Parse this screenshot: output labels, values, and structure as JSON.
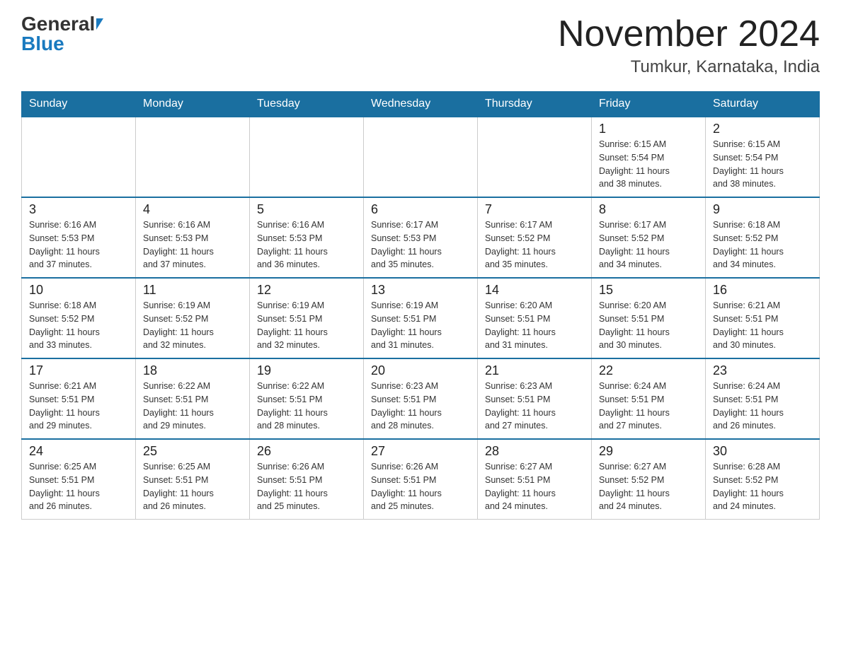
{
  "header": {
    "logo_general": "General",
    "logo_blue": "Blue",
    "month_title": "November 2024",
    "location": "Tumkur, Karnataka, India"
  },
  "weekdays": [
    "Sunday",
    "Monday",
    "Tuesday",
    "Wednesday",
    "Thursday",
    "Friday",
    "Saturday"
  ],
  "weeks": [
    {
      "days": [
        {
          "num": "",
          "info": ""
        },
        {
          "num": "",
          "info": ""
        },
        {
          "num": "",
          "info": ""
        },
        {
          "num": "",
          "info": ""
        },
        {
          "num": "",
          "info": ""
        },
        {
          "num": "1",
          "info": "Sunrise: 6:15 AM\nSunset: 5:54 PM\nDaylight: 11 hours\nand 38 minutes."
        },
        {
          "num": "2",
          "info": "Sunrise: 6:15 AM\nSunset: 5:54 PM\nDaylight: 11 hours\nand 38 minutes."
        }
      ]
    },
    {
      "days": [
        {
          "num": "3",
          "info": "Sunrise: 6:16 AM\nSunset: 5:53 PM\nDaylight: 11 hours\nand 37 minutes."
        },
        {
          "num": "4",
          "info": "Sunrise: 6:16 AM\nSunset: 5:53 PM\nDaylight: 11 hours\nand 37 minutes."
        },
        {
          "num": "5",
          "info": "Sunrise: 6:16 AM\nSunset: 5:53 PM\nDaylight: 11 hours\nand 36 minutes."
        },
        {
          "num": "6",
          "info": "Sunrise: 6:17 AM\nSunset: 5:53 PM\nDaylight: 11 hours\nand 35 minutes."
        },
        {
          "num": "7",
          "info": "Sunrise: 6:17 AM\nSunset: 5:52 PM\nDaylight: 11 hours\nand 35 minutes."
        },
        {
          "num": "8",
          "info": "Sunrise: 6:17 AM\nSunset: 5:52 PM\nDaylight: 11 hours\nand 34 minutes."
        },
        {
          "num": "9",
          "info": "Sunrise: 6:18 AM\nSunset: 5:52 PM\nDaylight: 11 hours\nand 34 minutes."
        }
      ]
    },
    {
      "days": [
        {
          "num": "10",
          "info": "Sunrise: 6:18 AM\nSunset: 5:52 PM\nDaylight: 11 hours\nand 33 minutes."
        },
        {
          "num": "11",
          "info": "Sunrise: 6:19 AM\nSunset: 5:52 PM\nDaylight: 11 hours\nand 32 minutes."
        },
        {
          "num": "12",
          "info": "Sunrise: 6:19 AM\nSunset: 5:51 PM\nDaylight: 11 hours\nand 32 minutes."
        },
        {
          "num": "13",
          "info": "Sunrise: 6:19 AM\nSunset: 5:51 PM\nDaylight: 11 hours\nand 31 minutes."
        },
        {
          "num": "14",
          "info": "Sunrise: 6:20 AM\nSunset: 5:51 PM\nDaylight: 11 hours\nand 31 minutes."
        },
        {
          "num": "15",
          "info": "Sunrise: 6:20 AM\nSunset: 5:51 PM\nDaylight: 11 hours\nand 30 minutes."
        },
        {
          "num": "16",
          "info": "Sunrise: 6:21 AM\nSunset: 5:51 PM\nDaylight: 11 hours\nand 30 minutes."
        }
      ]
    },
    {
      "days": [
        {
          "num": "17",
          "info": "Sunrise: 6:21 AM\nSunset: 5:51 PM\nDaylight: 11 hours\nand 29 minutes."
        },
        {
          "num": "18",
          "info": "Sunrise: 6:22 AM\nSunset: 5:51 PM\nDaylight: 11 hours\nand 29 minutes."
        },
        {
          "num": "19",
          "info": "Sunrise: 6:22 AM\nSunset: 5:51 PM\nDaylight: 11 hours\nand 28 minutes."
        },
        {
          "num": "20",
          "info": "Sunrise: 6:23 AM\nSunset: 5:51 PM\nDaylight: 11 hours\nand 28 minutes."
        },
        {
          "num": "21",
          "info": "Sunrise: 6:23 AM\nSunset: 5:51 PM\nDaylight: 11 hours\nand 27 minutes."
        },
        {
          "num": "22",
          "info": "Sunrise: 6:24 AM\nSunset: 5:51 PM\nDaylight: 11 hours\nand 27 minutes."
        },
        {
          "num": "23",
          "info": "Sunrise: 6:24 AM\nSunset: 5:51 PM\nDaylight: 11 hours\nand 26 minutes."
        }
      ]
    },
    {
      "days": [
        {
          "num": "24",
          "info": "Sunrise: 6:25 AM\nSunset: 5:51 PM\nDaylight: 11 hours\nand 26 minutes."
        },
        {
          "num": "25",
          "info": "Sunrise: 6:25 AM\nSunset: 5:51 PM\nDaylight: 11 hours\nand 26 minutes."
        },
        {
          "num": "26",
          "info": "Sunrise: 6:26 AM\nSunset: 5:51 PM\nDaylight: 11 hours\nand 25 minutes."
        },
        {
          "num": "27",
          "info": "Sunrise: 6:26 AM\nSunset: 5:51 PM\nDaylight: 11 hours\nand 25 minutes."
        },
        {
          "num": "28",
          "info": "Sunrise: 6:27 AM\nSunset: 5:51 PM\nDaylight: 11 hours\nand 24 minutes."
        },
        {
          "num": "29",
          "info": "Sunrise: 6:27 AM\nSunset: 5:52 PM\nDaylight: 11 hours\nand 24 minutes."
        },
        {
          "num": "30",
          "info": "Sunrise: 6:28 AM\nSunset: 5:52 PM\nDaylight: 11 hours\nand 24 minutes."
        }
      ]
    }
  ]
}
